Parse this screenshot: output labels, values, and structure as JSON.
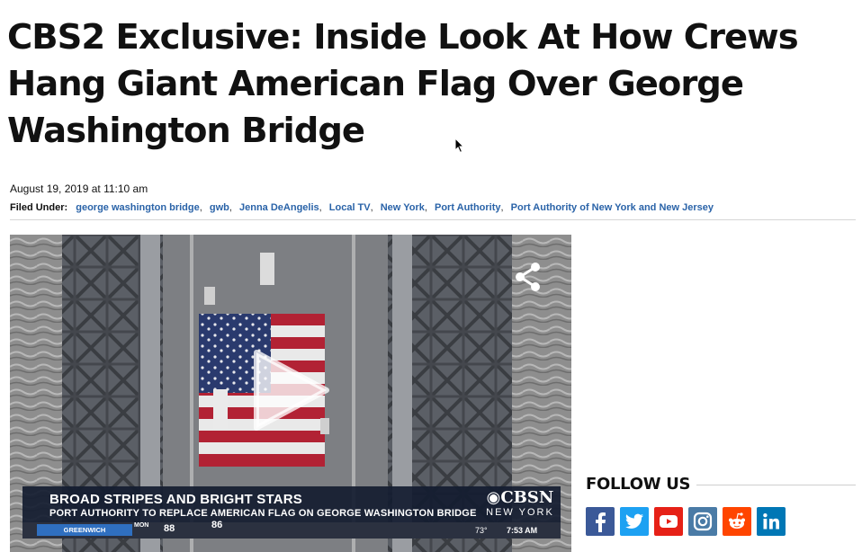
{
  "article": {
    "headline": "CBS2 Exclusive: Inside Look At How Crews Hang Giant American Flag Over George Washington Bridge",
    "date": "August 19, 2019 at 11:10 am",
    "filed_under_label": "Filed Under:",
    "tags": [
      "george washington bridge",
      "gwb",
      "Jenna DeAngelis",
      "Local TV",
      "New York",
      "Port Authority",
      "Port Authority of New York and New Jersey"
    ]
  },
  "video": {
    "lower_third_title": "BROAD STRIPES AND BRIGHT STARS",
    "lower_third_subtitle": "PORT AUTHORITY TO REPLACE AMERICAN FLAG ON GEORGE WASHINGTON BRIDGE",
    "network_logo": "CBSN",
    "network_city": "NEW YORK",
    "ticker_location": "GREENWICH",
    "ticker_day": "MON",
    "ticker_temp_1": "88",
    "ticker_temp_2": "86",
    "current_temp": "73°",
    "current_time": "7:53 AM",
    "icons": [
      "share-icon",
      "play-icon"
    ]
  },
  "sidebar": {
    "follow_title": "FOLLOW US",
    "social": [
      {
        "name": "facebook-icon",
        "color": "#3b5998"
      },
      {
        "name": "twitter-icon",
        "color": "#1da1f2"
      },
      {
        "name": "youtube-icon",
        "color": "#e62117"
      },
      {
        "name": "instagram-icon",
        "color": "#4a7ba6"
      },
      {
        "name": "reddit-icon",
        "color": "#ff4500"
      },
      {
        "name": "linkedin-icon",
        "color": "#0077b5"
      }
    ]
  },
  "colors": {
    "tag_link": "#2a63a8",
    "lower_third_bg": "#141c30",
    "ticker_location_bg": "#2f6fc0"
  }
}
